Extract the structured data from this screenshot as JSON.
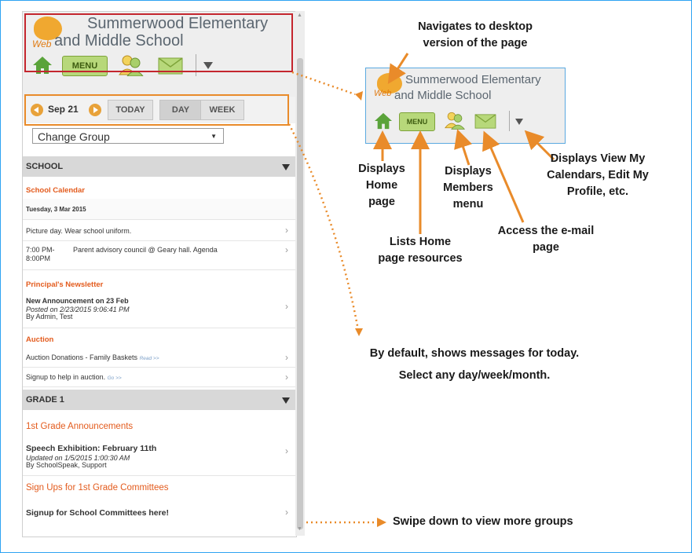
{
  "school": {
    "line1": "Summerwood Elementary",
    "line2": "and Middle School",
    "web": "Web"
  },
  "toolbar": {
    "menu_label": "MENU"
  },
  "datebar": {
    "date": "Sep 21",
    "today": "TODAY",
    "day": "DAY",
    "week": "WEEK"
  },
  "group_select": {
    "value": "Change Group"
  },
  "sections": {
    "school": "SCHOOL",
    "grade1": "GRADE 1"
  },
  "school_items": {
    "cal_title": "School Calendar",
    "date_header": "Tuesday, 3 Mar 2015",
    "item1": "Picture day. Wear school uniform.",
    "item2_time1": "7:00 PM-",
    "item2_time2": "8:00PM",
    "item2_text": "Parent advisory council @ Geary hall. Agenda",
    "news_title": "Principal's Newsletter",
    "news_item": "New Announcement on 23 Feb",
    "news_posted": "Posted on 2/23/2015 9:06:41 PM",
    "news_by": "By Admin, Test",
    "auction_title": "Auction",
    "auction1": "Auction Donations - Family Baskets",
    "auction1_link": "Read >>",
    "auction2": "Signup to help in auction.",
    "auction2_link": "Go >>"
  },
  "grade1_items": {
    "ann_title": "1st Grade Announcements",
    "ann_item": "Speech Exhibition: February 11th",
    "ann_updated": "Updated on 1/5/2015 1:00:30 AM",
    "ann_by": "By SchoolSpeak, Support",
    "signup_title": "Sign Ups for 1st Grade Committees",
    "signup_item": "Signup for School Committees here!"
  },
  "annotations": {
    "desktop1": "Navigates to desktop",
    "desktop2": "version of the page",
    "home1": "Displays",
    "home2": "Home",
    "home3": "page",
    "menu1": "Lists Home",
    "menu2": "page resources",
    "members1": "Displays",
    "members2": "Members",
    "members3": "menu",
    "email1": "Access the e-mail",
    "email2": "page",
    "dropdown1": "Displays View My",
    "dropdown2": "Calendars, Edit My",
    "dropdown3": "Profile, etc.",
    "default1": "By default, shows messages for today.",
    "default2": "Select any day/week/month.",
    "swipe": "Swipe down to view more groups"
  },
  "colors": {
    "accent": "#e98b2a",
    "frame": "#2ea3f2",
    "red_box": "#c4262e",
    "category": "#e35b1d"
  }
}
